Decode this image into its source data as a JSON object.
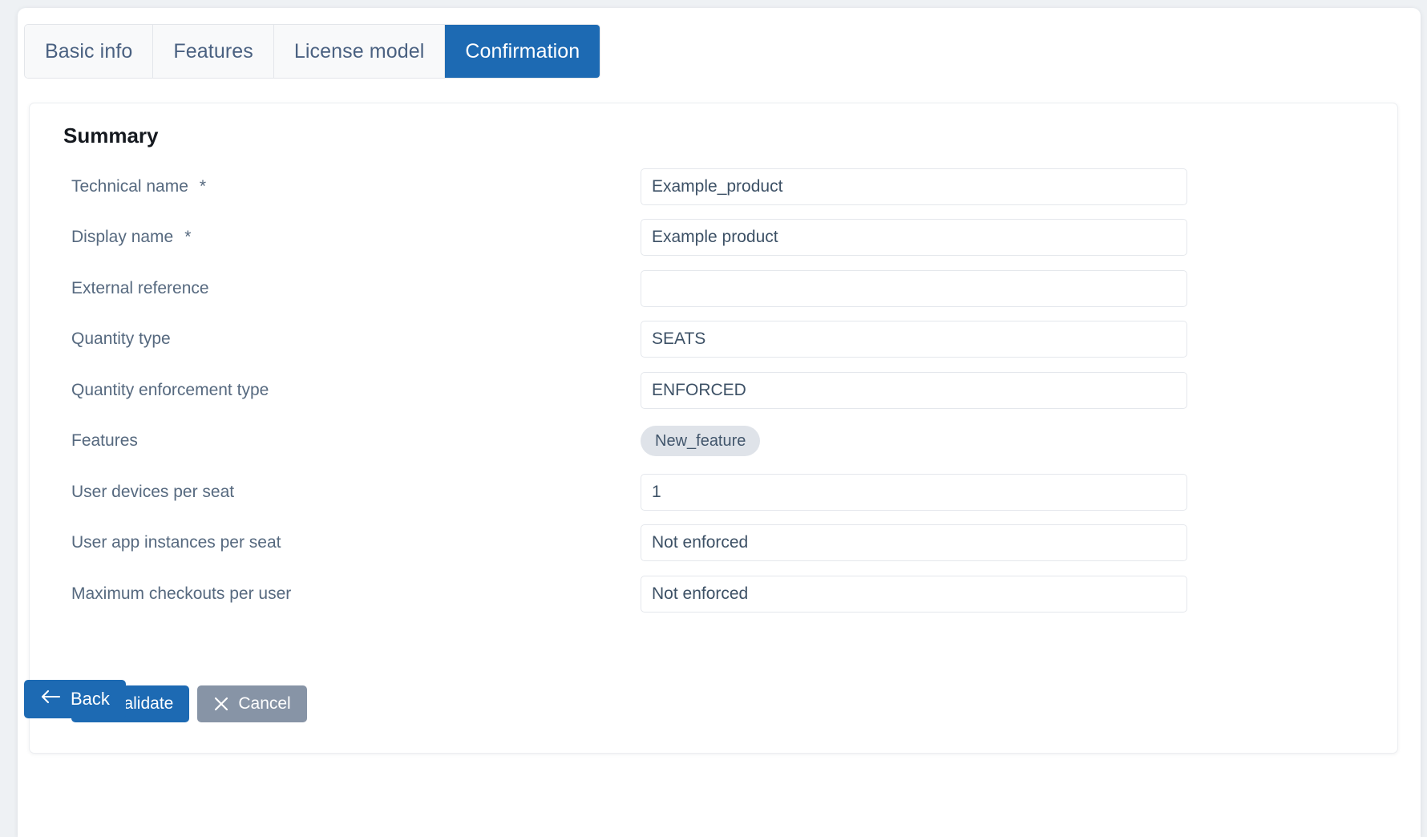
{
  "tabs": [
    {
      "label": "Basic info",
      "active": false
    },
    {
      "label": "Features",
      "active": false
    },
    {
      "label": "License model",
      "active": false
    },
    {
      "label": "Confirmation",
      "active": true
    }
  ],
  "card": {
    "title": "Summary",
    "rows": [
      {
        "label": "Technical name",
        "required": "*",
        "type": "input",
        "value": "Example_product",
        "placeholder": ""
      },
      {
        "label": "Display name",
        "required": "*",
        "type": "input",
        "value": "Example product",
        "placeholder": ""
      },
      {
        "label": "External reference",
        "required": "",
        "type": "input",
        "value": "",
        "placeholder": ""
      },
      {
        "label": "Quantity type",
        "required": "",
        "type": "input",
        "value": "SEATS",
        "placeholder": ""
      },
      {
        "label": "Quantity enforcement type",
        "required": "",
        "type": "input",
        "value": "ENFORCED",
        "placeholder": ""
      },
      {
        "label": "Features",
        "required": "",
        "type": "chip",
        "value": "New_feature",
        "placeholder": ""
      },
      {
        "label": "User devices per seat",
        "required": "",
        "type": "input",
        "value": "1",
        "placeholder": ""
      },
      {
        "label": "User app instances per seat",
        "required": "",
        "type": "input",
        "value": "Not enforced",
        "placeholder": ""
      },
      {
        "label": "Maximum checkouts per user",
        "required": "",
        "type": "input",
        "value": "Not enforced",
        "placeholder": ""
      }
    ],
    "actions": {
      "validate_label": "Validate",
      "validate_icon": "check-icon",
      "cancel_label": "Cancel",
      "cancel_icon": "close-icon"
    }
  },
  "footer": {
    "back_label": "Back",
    "back_icon": "arrow-left-icon"
  },
  "colors": {
    "accent": "#1d6ab3",
    "secondary": "#8794a6",
    "label_text": "#56697f",
    "value_text": "#3d5166",
    "chip_bg": "#dfe3e9",
    "page_bg": "#eef1f4",
    "tab_inactive_bg": "#f8f9fa",
    "border": "#e4e7ec"
  }
}
